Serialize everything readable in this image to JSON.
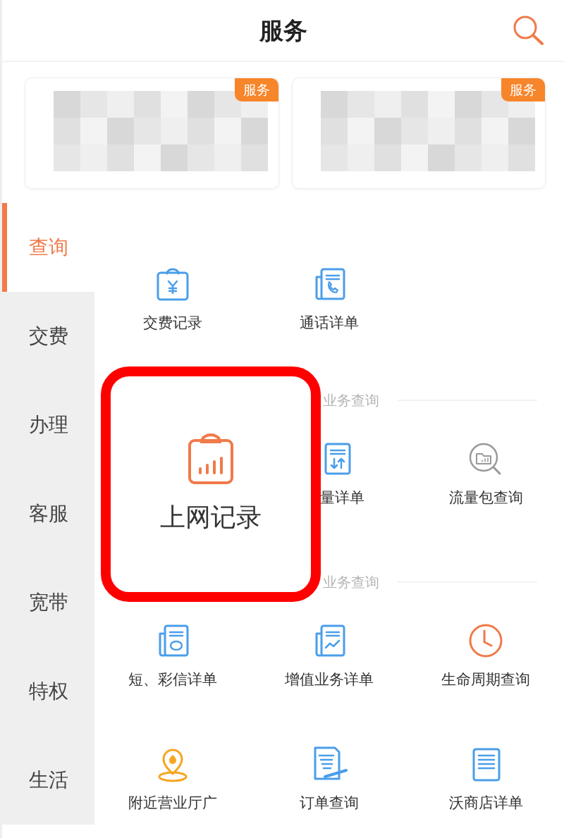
{
  "header": {
    "title": "服务"
  },
  "cards": [
    {
      "badge": "服务"
    },
    {
      "badge": "服务"
    }
  ],
  "sidebar": {
    "items": [
      {
        "label": "查询",
        "selected": true
      },
      {
        "label": "交费",
        "selected": false
      },
      {
        "label": "办理",
        "selected": false
      },
      {
        "label": "客服",
        "selected": false
      },
      {
        "label": "宽带",
        "selected": false
      },
      {
        "label": "特权",
        "selected": false
      },
      {
        "label": "生活",
        "selected": false
      }
    ]
  },
  "sections": [
    {
      "items": [
        {
          "kind": "bill",
          "label": "交费记录"
        },
        {
          "kind": "call",
          "label": "通话详单"
        }
      ]
    },
    {
      "header": "业务查询",
      "items": [
        {
          "kind": "covered"
        },
        {
          "kind": "traffic",
          "label": "量详单"
        },
        {
          "kind": "package",
          "label": "流量包查询"
        }
      ]
    },
    {
      "header": "业务查询",
      "items": [
        {
          "kind": "sms",
          "label": "短、彩信详单"
        },
        {
          "kind": "value",
          "label": "增值业务详单"
        },
        {
          "kind": "clock",
          "label": "生命周期查询"
        }
      ]
    },
    {
      "items": [
        {
          "kind": "pin",
          "label": "附近营业厅广"
        },
        {
          "kind": "order",
          "label": "订单查询"
        },
        {
          "kind": "shop",
          "label": "沃商店详单"
        }
      ]
    }
  ],
  "highlight": {
    "label": "上网记录"
  }
}
